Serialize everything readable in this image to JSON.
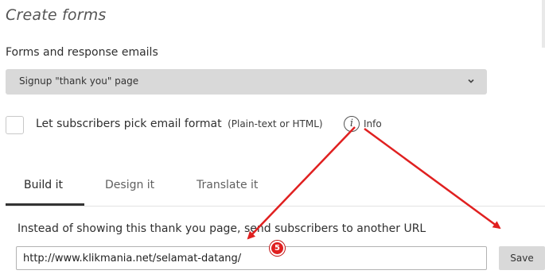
{
  "header": {
    "title": "Create forms"
  },
  "forms": {
    "label": "Forms and response emails",
    "selected": "Signup \"thank you\" page"
  },
  "email_format": {
    "label": "Let subscribers pick email format",
    "sub_label": "(Plain-text or HTML)",
    "info_label": "Info",
    "checked": false
  },
  "tabs": [
    {
      "label": "Build it",
      "active": true
    },
    {
      "label": "Design it",
      "active": false
    },
    {
      "label": "Translate it",
      "active": false
    }
  ],
  "redirect": {
    "label": "Instead of showing this thank you page, send subscribers to another URL",
    "url_value": "http://www.klikmania.net/selamat-datang/",
    "save_label": "Save"
  },
  "annotation": {
    "step_number": "5",
    "color": "#e02020"
  }
}
